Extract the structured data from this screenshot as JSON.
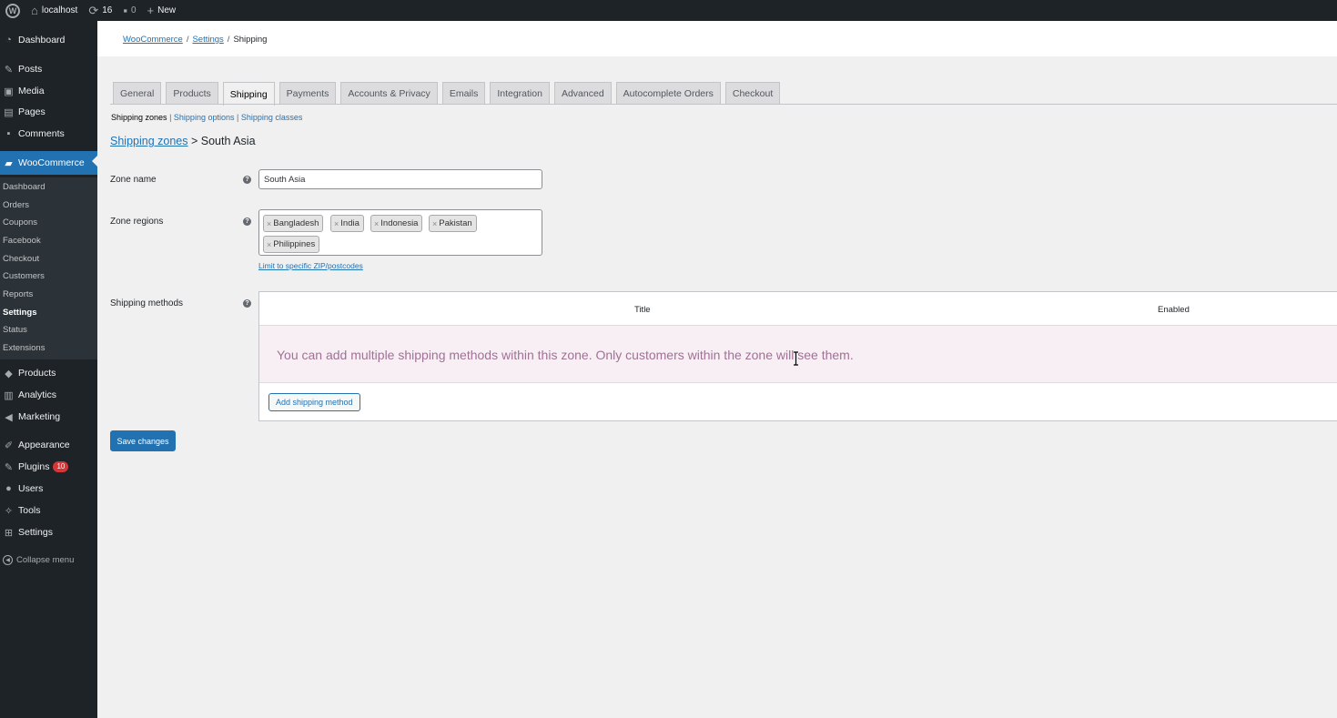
{
  "adminbar": {
    "site_name": "localhost",
    "updates_count": "16",
    "comments_count": "0",
    "new_label": "New"
  },
  "sidebar": {
    "items": [
      {
        "label": "Dashboard",
        "icon": "dashboard-icon"
      },
      {
        "label": "Posts",
        "icon": "pin-icon"
      },
      {
        "label": "Media",
        "icon": "media-icon"
      },
      {
        "label": "Pages",
        "icon": "page-icon"
      },
      {
        "label": "Comments",
        "icon": "comment-icon"
      },
      {
        "label": "WooCommerce",
        "icon": "woo-icon"
      },
      {
        "label": "Products",
        "icon": "box-icon"
      },
      {
        "label": "Analytics",
        "icon": "bar-chart-icon"
      },
      {
        "label": "Marketing",
        "icon": "megaphone-icon"
      },
      {
        "label": "Appearance",
        "icon": "brush-icon"
      },
      {
        "label": "Plugins",
        "icon": "plug-icon",
        "badge": "10"
      },
      {
        "label": "Users",
        "icon": "user-icon"
      },
      {
        "label": "Tools",
        "icon": "wrench-icon"
      },
      {
        "label": "Settings",
        "icon": "settings-icon"
      }
    ],
    "woo_submenu": [
      "Dashboard",
      "Orders",
      "Coupons",
      "Facebook",
      "Checkout",
      "Customers",
      "Reports",
      "Settings",
      "Status",
      "Extensions"
    ],
    "current_sub": "Settings",
    "collapse_label": "Collapse menu"
  },
  "breadcrumb": {
    "items": [
      "WooCommerce",
      "Settings"
    ],
    "current": "Shipping",
    "separator": "/"
  },
  "tabs": [
    "General",
    "Products",
    "Shipping",
    "Payments",
    "Accounts & Privacy",
    "Emails",
    "Integration",
    "Advanced",
    "Autocomplete Orders",
    "Checkout"
  ],
  "active_tab": "Shipping",
  "subsections": {
    "current": "Shipping zones",
    "links": [
      "Shipping options",
      "Shipping classes"
    ],
    "separator": "|"
  },
  "zone": {
    "heading_link": "Shipping zones",
    "heading_separator": ">",
    "heading_name": "South Asia",
    "name_label": "Zone name",
    "name_value": "South Asia",
    "regions_label": "Zone regions",
    "regions": [
      "Bangladesh",
      "India",
      "Indonesia",
      "Pakistan",
      "Philippines"
    ],
    "remove_glyph": "×",
    "postcode_link": "Limit to specific ZIP/postcodes",
    "help_glyph": "?"
  },
  "methods": {
    "label": "Shipping methods",
    "col_title": "Title",
    "col_enabled": "Enabled",
    "blank_message": "You can add multiple shipping methods within this zone. Only customers within the zone will see them.",
    "add_button": "Add shipping method"
  },
  "save_button": "Save changes",
  "colors": {
    "accent": "#2271b1",
    "admin_dark": "#1d2327",
    "blank_row_bg": "#f8eff4",
    "blank_row_text": "#9f7295",
    "badge": "#d63638"
  }
}
